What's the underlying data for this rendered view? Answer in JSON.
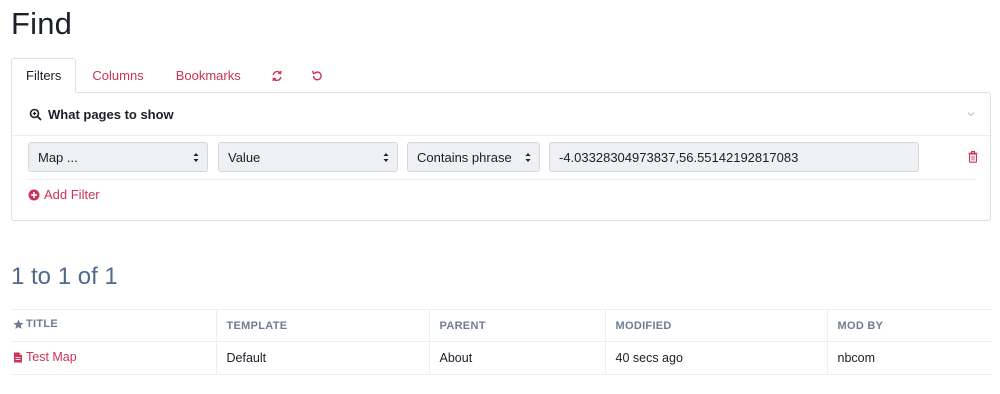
{
  "page": {
    "title": "Find"
  },
  "tabs": [
    {
      "label": "Filters",
      "active": true
    },
    {
      "label": "Columns"
    },
    {
      "label": "Bookmarks"
    },
    {
      "icon": "refresh-icon"
    },
    {
      "icon": "reset-icon"
    }
  ],
  "filters": {
    "heading": "What pages to show",
    "heading_icon": "search-icon",
    "rows": [
      {
        "field": "Map ...",
        "subfield": "Value",
        "operator": "Contains phrase",
        "value": "-4.03328304973837,56.55142192817083"
      }
    ],
    "add_label": "Add Filter"
  },
  "results": {
    "count_text": "1 to 1 of 1",
    "columns": [
      "TITLE",
      "TEMPLATE",
      "PARENT",
      "MODIFIED",
      "MOD BY"
    ],
    "rows": [
      {
        "title": "Test Map",
        "template": "Default",
        "parent": "About",
        "modified": "40 secs ago",
        "mod_by": "nbcom"
      }
    ]
  },
  "colors": {
    "accent": "#cc3358",
    "heading": "#4f6a8c",
    "muted": "#6e7d93"
  }
}
